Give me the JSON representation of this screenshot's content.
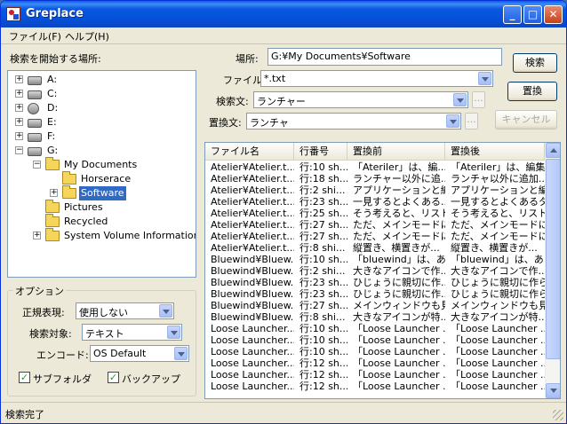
{
  "window": {
    "title": "Greplace"
  },
  "menu": [
    {
      "label": "ファイル(F)"
    },
    {
      "label": "ヘルプ(H)"
    }
  ],
  "left": {
    "search_location_label": "検索を開始する場所:",
    "tree": [
      {
        "label": "A:",
        "icon": "floppy-drive-icon",
        "expander": "+"
      },
      {
        "label": "C:",
        "icon": "hard-drive-icon",
        "expander": "+"
      },
      {
        "label": "D:",
        "icon": "cd-drive-icon",
        "expander": "+"
      },
      {
        "label": "E:",
        "icon": "hard-drive-icon",
        "expander": "+"
      },
      {
        "label": "F:",
        "icon": "hard-drive-icon",
        "expander": "+"
      },
      {
        "label": "G:",
        "icon": "hard-drive-icon",
        "expander": "−"
      },
      {
        "label": "My Documents",
        "icon": "folder-open-icon",
        "expander": "−"
      },
      {
        "label": "Horserace",
        "icon": "folder-icon",
        "expander": ""
      },
      {
        "label": "Software",
        "icon": "folder-icon",
        "expander": "+",
        "selected": true
      },
      {
        "label": "Pictures",
        "icon": "folder-icon",
        "expander": ""
      },
      {
        "label": "Recycled",
        "icon": "folder-icon",
        "expander": ""
      },
      {
        "label": "System Volume Information",
        "icon": "folder-icon",
        "expander": "+"
      }
    ],
    "options": {
      "title": "オプション",
      "regex_label": "正規表現:",
      "regex_value": "使用しない",
      "target_label": "検索対象:",
      "target_value": "テキスト",
      "encoding_label": "エンコード:",
      "encoding_value": "OS Default",
      "subfolder_label": "サブフォルダ",
      "subfolder_checked": true,
      "backup_label": "バックアップ",
      "backup_checked": true
    }
  },
  "form": {
    "location_label": "場所:",
    "location_value": "G:¥My Documents¥Software",
    "file_label": "ファイル:",
    "file_value": "*.txt",
    "search_text_label": "検索文:",
    "search_text_value": "ランチャー",
    "replace_text_label": "置換文:",
    "replace_text_value": "ランチャ",
    "mini_button_label": "..."
  },
  "buttons": {
    "search": "検索",
    "replace": "置換",
    "cancel": "キャンセル"
  },
  "results": {
    "columns": [
      "ファイル名",
      "行番号",
      "置換前",
      "置換後"
    ],
    "rows": [
      [
        "Atelier¥Atelier.t...",
        "行:10 sh...",
        "「Ateriler」は、編...",
        "「Ateriler」は、編集..."
      ],
      [
        "Atelier¥Atelier.t...",
        "行:18 sh...",
        "ランチャー以外に追...",
        "ランチャ以外に追加..."
      ],
      [
        "Atelier¥Atelier.t...",
        "行:2 shi...",
        "アプリケーションと編...",
        "アプリケーションと編..."
      ],
      [
        "Atelier¥Atelier.t...",
        "行:23 sh...",
        "一見するとよくある...",
        "一見するとよくあるタ..."
      ],
      [
        "Atelier¥Atelier.t...",
        "行:25 sh...",
        "そう考えると、リスト...",
        "そう考えると、リスト..."
      ],
      [
        "Atelier¥Atelier.t...",
        "行:27 sh...",
        "ただ、メインモードに...",
        "ただ、メインモードに..."
      ],
      [
        "Atelier¥Atelier.t...",
        "行:27 sh...",
        "ただ、メインモードに...",
        "ただ、メインモードに..."
      ],
      [
        "Atelier¥Atelier.t...",
        "行:8 shi...",
        "縦置き、横置きが...",
        "縦置き、横置きが..."
      ],
      [
        "Bluewind¥Bluew...",
        "行:10 sh...",
        "「bluewind」は、あ...",
        "「bluewind」は、あら..."
      ],
      [
        "Bluewind¥Bluew...",
        "行:2 shi...",
        "大きなアイコンで作...",
        "大きなアイコンで作..."
      ],
      [
        "Bluewind¥Bluew...",
        "行:23 sh...",
        "ひじょうに親切に作...",
        "ひじょうに親切に作ら..."
      ],
      [
        "Bluewind¥Bluew...",
        "行:23 sh...",
        "ひじょうに親切に作...",
        "ひじょうに親切に作ら..."
      ],
      [
        "Bluewind¥Bluew...",
        "行:27 sh...",
        "メインウィンドウも見...",
        "メインウィンドウも見..."
      ],
      [
        "Bluewind¥Bluew...",
        "行:8 shi...",
        "大きなアイコンが特...",
        "大きなアイコンが特..."
      ],
      [
        "Loose Launcher...",
        "行:10 sh...",
        "「Loose Launcher ...",
        "「Loose Launcher ..."
      ],
      [
        "Loose Launcher...",
        "行:10 sh...",
        "「Loose Launcher ...",
        "「Loose Launcher ..."
      ],
      [
        "Loose Launcher...",
        "行:10 sh...",
        "「Loose Launcher ...",
        "「Loose Launcher ..."
      ],
      [
        "Loose Launcher...",
        "行:12 sh...",
        "「Loose Launcher ...",
        "「Loose Launcher ..."
      ],
      [
        "Loose Launcher...",
        "行:12 sh...",
        "「Loose Launcher ...",
        "「Loose Launcher ..."
      ],
      [
        "Loose Launcher...",
        "行:12 sh...",
        "「Loose Launcher ...",
        "「Loose Launcher ..."
      ]
    ]
  },
  "status": {
    "text": "検索完了"
  }
}
